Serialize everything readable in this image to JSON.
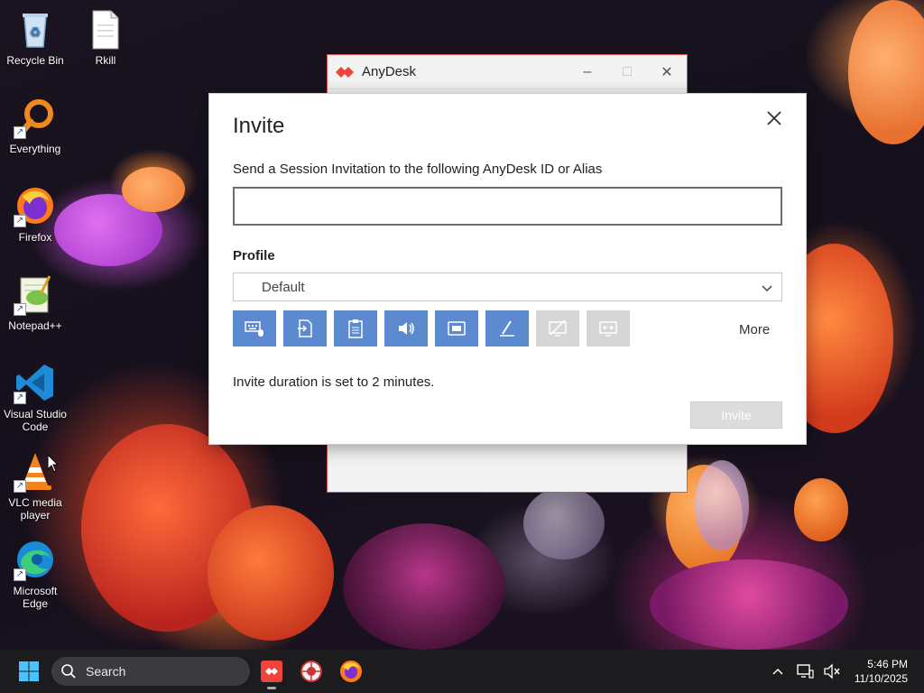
{
  "desktop": {
    "icons": [
      {
        "label": "Recycle Bin",
        "icon": "recycle-bin-icon"
      },
      {
        "label": "Rkill",
        "icon": "document-icon"
      },
      {
        "label": "Everything",
        "icon": "magnifier-icon"
      },
      {
        "label": "Firefox",
        "icon": "firefox-icon"
      },
      {
        "label": "Notepad++",
        "icon": "notepad-plus-plus-icon"
      },
      {
        "label": "Visual Studio Code",
        "icon": "vscode-icon"
      },
      {
        "label": "VLC media player",
        "icon": "vlc-icon"
      },
      {
        "label": "Microsoft Edge",
        "icon": "edge-icon"
      }
    ]
  },
  "anydesk_window": {
    "title": "AnyDesk",
    "controls": {
      "minimize": "–",
      "maximize": "□",
      "close": "✕"
    }
  },
  "invite_dialog": {
    "title": "Invite",
    "id_label": "Send a Session Invitation to the following AnyDesk ID or Alias",
    "id_value": "",
    "profile_label": "Profile",
    "profile_value": "Default",
    "permissions": [
      {
        "name": "keyboard-mouse-permission",
        "enabled": true
      },
      {
        "name": "file-transfer-permission",
        "enabled": true
      },
      {
        "name": "clipboard-permission",
        "enabled": true
      },
      {
        "name": "sound-permission",
        "enabled": true
      },
      {
        "name": "screen-recording-permission",
        "enabled": true
      },
      {
        "name": "whiteboard-permission",
        "enabled": true
      },
      {
        "name": "privacy-mode-permission",
        "enabled": false
      },
      {
        "name": "block-input-permission",
        "enabled": false
      }
    ],
    "more_label": "More",
    "duration_text": "Invite duration is set to 2 minutes.",
    "invite_button": "Invite",
    "invite_enabled": false
  },
  "taskbar": {
    "search_placeholder": "Search",
    "apps": [
      "anydesk-icon",
      "rkill-icon",
      "firefox-icon"
    ],
    "clock_time": "5:46 PM",
    "clock_date": "11/10/2025"
  },
  "colors": {
    "accent_blue": "#5b8ad0",
    "anydesk_red": "#ef443b",
    "taskbar_bg": "#1c1c1f"
  }
}
